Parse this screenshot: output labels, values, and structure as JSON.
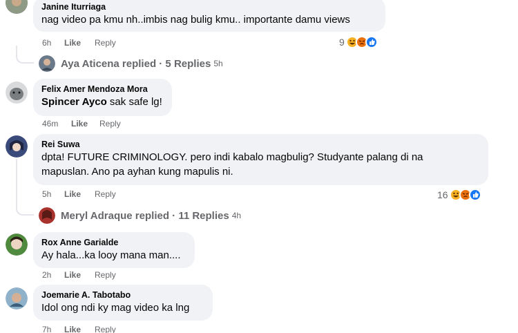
{
  "comments": [
    {
      "author": "Janine Iturriaga",
      "text": "nag video pa kmu nh..imbis nag bulig kmu.. importante damu views",
      "time": "6h",
      "like": "Like",
      "reply": "Reply",
      "reactions": {
        "count": "9",
        "types": [
          "haha-icon",
          "angry-icon",
          "like-icon"
        ]
      },
      "replies": {
        "author": "Aya Aticena",
        "label": "Aya Aticena replied · 5 Replies",
        "time": "5h"
      }
    },
    {
      "author": "Felix Amer Mendoza Mora",
      "mention": "Spincer Ayco",
      "text": " sak safe lg!",
      "time": "46m",
      "like": "Like",
      "reply": "Reply"
    },
    {
      "author": "Rei Suwa",
      "text_line1": "dpta! FUTURE CRIMINOLOGY. pero indi kabalo magbulig? Studyante palang di na",
      "text_line2": "mapuslan. Ano pa ayhan kung mapulis ni.",
      "time": "5h",
      "like": "Like",
      "reply": "Reply",
      "reactions": {
        "count": "16",
        "types": [
          "haha-icon",
          "angry-icon",
          "like-icon"
        ]
      },
      "replies": {
        "author": "Meryl Adraque",
        "label": "Meryl Adraque replied · 11 Replies",
        "time": "4h"
      }
    },
    {
      "author": "Rox Anne Garialde",
      "text": "Ay hala...ka looy mana man....",
      "time": "2h",
      "like": "Like",
      "reply": "Reply"
    },
    {
      "author": "Joemarie A. Tabotabo",
      "text": "Idol ong ndi ky mag video ka lng",
      "time": "7h",
      "like": "Like",
      "reply": "Reply"
    }
  ],
  "colors": {
    "bubble": "#f0f2f5",
    "meta": "#65676b",
    "like_blue": "#1877f2",
    "haha_yellow": "#f7b125",
    "angry_orange": "#e9710f"
  }
}
